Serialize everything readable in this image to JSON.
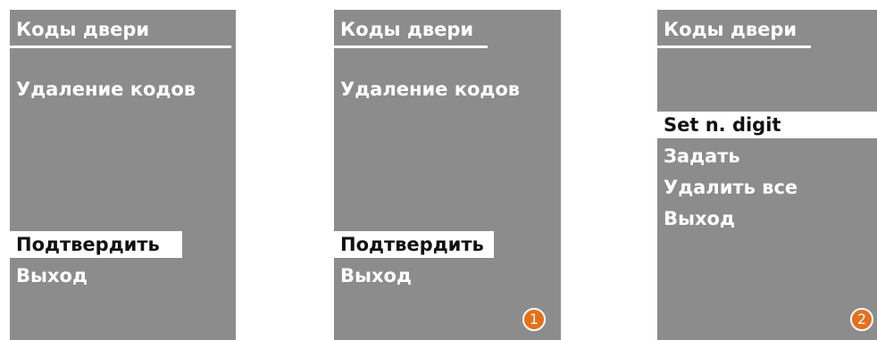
{
  "screens": [
    {
      "title": "Коды двери",
      "items": [
        "Удаление кодов",
        "Подтвердить",
        "Выход"
      ]
    },
    {
      "title": "Коды двери",
      "items": [
        "Удаление кодов",
        "Подтвердить",
        "Выход"
      ],
      "badge": "1"
    },
    {
      "title": "Коды двери",
      "items": [
        "Set n. digit",
        "Задать",
        "Удалить все",
        "Выход"
      ],
      "badge": "2"
    }
  ],
  "colors": {
    "screen_bg": "#8c8c8c",
    "text": "#ffffff",
    "selection_bg": "#ffffff",
    "selection_text": "#111111",
    "badge": "#e66f1a"
  }
}
